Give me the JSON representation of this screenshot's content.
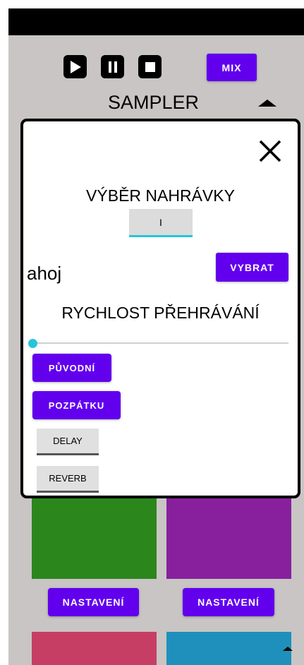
{
  "transport": {
    "play_icon": "play-icon",
    "pause_icon": "pause-icon",
    "stop_icon": "stop-icon",
    "mix_label": "MIX"
  },
  "sampler": {
    "title": "SAMPLER",
    "toggle_icon": "triangle-up-icon"
  },
  "dialog": {
    "close_icon": "close-icon",
    "selection_title": "VÝBĚR NAHRÁVKY",
    "selection_value": "I",
    "recording_name": "ahoj",
    "choose_label": "VYBRAT",
    "speed_title": "RYCHLOST PŘEHRÁVÁNÍ",
    "speed_fraction": 0.0,
    "original_label": "PŮVODNÍ",
    "reverse_label": "POZPÁTKU",
    "delay_label": "DELAY",
    "reverb_label": "REVERB"
  },
  "pads": {
    "settings_label_1": "NASTAVENÍ",
    "settings_label_2": "NASTAVENÍ",
    "colors": [
      "#2b861c",
      "#88209e",
      "#c73e65",
      "#1f90bb"
    ]
  },
  "colors": {
    "accent": "#6200ee",
    "slider": "#26c6da",
    "background": "#c8c5c4"
  }
}
